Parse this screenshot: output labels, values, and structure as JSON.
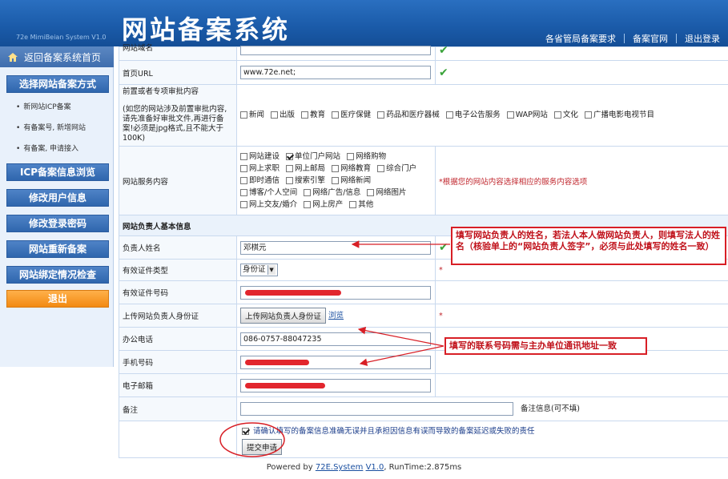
{
  "header": {
    "system_en": "72e MimiBeian System V1.0",
    "title": "网站备案系统",
    "links": [
      "各省管局备案要求",
      "备案官网",
      "退出登录"
    ]
  },
  "sidebar": {
    "home": "返回备案系统首页",
    "choose": "选择网站备案方式",
    "sub_items": [
      "新网站ICP备案",
      "有备案号, 新增网站",
      "有备案, 申请接入"
    ],
    "buttons": [
      "ICP备案信息浏览",
      "修改用户信息",
      "修改登录密码",
      "网站重新备案",
      "网站绑定情况检查"
    ],
    "exit": "退出"
  },
  "form": {
    "site_name_label": "网站域名",
    "homepage_label": "首页URL",
    "homepage_value": "www.72e.net;",
    "preapproval_label": "前置或者专项审批内容",
    "preapproval_note": "(如您的网站涉及前置审批内容, 请先准备好审批文件,再进行备案!必须是jpg格式,且不能大于100K)",
    "preapproval_options": [
      "新闻",
      "出版",
      "教育",
      "医疗保健",
      "药品和医疗器械",
      "电子公告服务",
      "WAP网站",
      "文化",
      "广播电影电视节目"
    ],
    "service_label": "网站服务内容",
    "service_options": [
      {
        "label": "网站建设",
        "checked": false
      },
      {
        "label": "单位门户网站",
        "checked": true
      },
      {
        "label": "网络购物",
        "checked": false
      },
      {
        "label": "网上求职",
        "checked": false
      },
      {
        "label": "网上邮局",
        "checked": false
      },
      {
        "label": "网络教育",
        "checked": false
      },
      {
        "label": "综合门户",
        "checked": false
      },
      {
        "label": "即时通信",
        "checked": false
      },
      {
        "label": "搜索引擎",
        "checked": false
      },
      {
        "label": "网络新闻",
        "checked": false
      },
      {
        "label": "博客/个人空间",
        "checked": false
      },
      {
        "label": "网络广告/信息",
        "checked": false
      },
      {
        "label": "网络图片",
        "checked": false
      },
      {
        "label": "网上交友/婚介",
        "checked": false
      },
      {
        "label": "网上房产",
        "checked": false
      },
      {
        "label": "其他",
        "checked": false
      }
    ],
    "service_tip": "*根据您的网站内容选择相应的服务内容选项",
    "section_title": "网站负责人基本信息",
    "name_label": "负责人姓名",
    "name_value": "邓棋元",
    "id_type_label": "有效证件类型",
    "id_type_value": "身份证",
    "id_number_label": "有效证件号码",
    "upload_label": "上传网站负责人身份证",
    "upload_button": "上传网站负责人身份证",
    "browse": "浏览",
    "office_phone_label": "办公电话",
    "office_phone_value": "086-0757-88047235",
    "mobile_label": "手机号码",
    "email_label": "电子邮箱",
    "remark_label": "备注",
    "remark_tip": "备注信息(可不填)",
    "confirm_text": "请确认填写的备案信息准确无误并且承担因信息有误而导致的备案延迟或失败的责任",
    "submit": "提交申请",
    "asterisk": "*"
  },
  "annotations": {
    "name_note": "填写网站负责人的姓名，若法人本人做网站负责人，则填写法人的姓名（核验单上的“网站负责人签字”，必须与此处填写的姓名一致）",
    "phone_note": "填写的联系号码需与主办单位通讯地址一致"
  },
  "footer": {
    "powered": "Powered by ",
    "brand": "72E.System",
    "version": "V1.0",
    "runtime": ", RunTime:2.875ms"
  },
  "colors": {
    "header_blue": "#1a5aa8",
    "annotation_red": "#d81f26",
    "exit_orange": "#f28a12"
  }
}
